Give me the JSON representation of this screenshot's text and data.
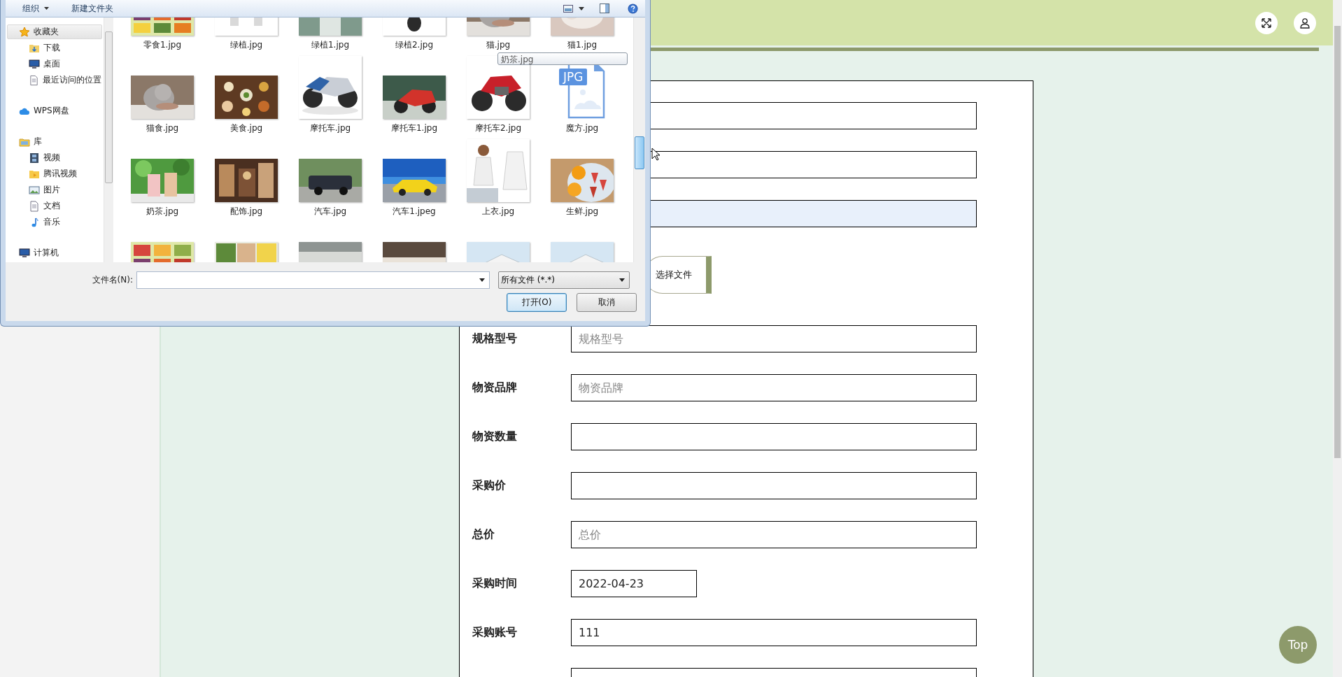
{
  "dialog": {
    "toolbar": {
      "organize": "组织",
      "new_folder": "新建文件夹"
    },
    "nav": [
      {
        "label": "收藏夹",
        "selected": true,
        "children": [
          {
            "label": "下载",
            "selected": false
          },
          {
            "label": "桌面",
            "selected": false
          },
          {
            "label": "最近访问的位置",
            "selected": false
          }
        ]
      },
      {
        "label": "WPS网盘",
        "selected": false
      },
      {
        "label": "库",
        "selected": false,
        "children": [
          {
            "label": "视频",
            "selected": false
          },
          {
            "label": "腾讯视频",
            "selected": false
          },
          {
            "label": "图片",
            "selected": false
          },
          {
            "label": "文档",
            "selected": false
          },
          {
            "label": "音乐",
            "selected": false
          }
        ]
      },
      {
        "label": "计算机",
        "selected": false
      }
    ],
    "files": [
      {
        "kind": "picture",
        "label": "零食1.jpg"
      },
      {
        "kind": "picture",
        "label": "绿植.jpg"
      },
      {
        "kind": "picture",
        "label": "绿植1.jpg"
      },
      {
        "kind": "picture",
        "label": "绿植2.jpg"
      },
      {
        "kind": "picture",
        "label": "猫.jpg"
      },
      {
        "kind": "picture",
        "label": "猫1.jpg"
      },
      {
        "kind": "picture",
        "label": "猫食.jpg"
      },
      {
        "kind": "picture",
        "label": "美食.jpg"
      },
      {
        "kind": "picture",
        "label": "摩托车.jpg"
      },
      {
        "kind": "picture",
        "label": "摩托车1.jpg"
      },
      {
        "kind": "picture",
        "label": "摩托车2.jpg"
      },
      {
        "kind": "file",
        "label": "魔方.jpg",
        "badge": "JPG"
      },
      {
        "kind": "picture",
        "label": "奶茶.jpg"
      },
      {
        "kind": "picture",
        "label": "配饰.jpg"
      },
      {
        "kind": "picture",
        "label": "汽车.jpg"
      },
      {
        "kind": "picture",
        "label": "汽车1.jpeg"
      },
      {
        "kind": "picture",
        "label": "上衣.jpg"
      },
      {
        "kind": "picture",
        "label": "生鲜.jpg"
      },
      {
        "kind": "picture"
      },
      {
        "kind": "picture"
      },
      {
        "kind": "picture"
      },
      {
        "kind": "picture"
      },
      {
        "kind": "picture"
      },
      {
        "kind": "picture"
      }
    ],
    "tooltip": "奶茶.jpg",
    "filename_label": "文件名(N):",
    "filter": "所有文件 (*.*)",
    "buttons": [
      {
        "label": "打开(O)",
        "default": true
      },
      {
        "label": "取消",
        "default": false
      }
    ]
  },
  "form": {
    "fields": [
      {
        "kind": "text",
        "highlighted": false
      },
      {
        "kind": "text",
        "highlighted": false
      },
      {
        "kind": "text",
        "highlighted": true
      },
      {
        "kind": "file",
        "button": "选择文件"
      },
      {
        "kind": "text",
        "label": "规格型号",
        "placeholder": "规格型号",
        "highlighted": false
      },
      {
        "kind": "text",
        "label": "物资品牌",
        "placeholder": "物资品牌",
        "highlighted": false
      },
      {
        "kind": "text",
        "label": "物资数量",
        "highlighted": false
      },
      {
        "kind": "text",
        "label": "采购价",
        "highlighted": false
      },
      {
        "kind": "text",
        "label": "总价",
        "placeholder": "总价",
        "highlighted": false
      },
      {
        "kind": "date",
        "label": "采购时间",
        "value": "2022-04-23"
      },
      {
        "kind": "text",
        "label": "采购账号",
        "value": "111",
        "highlighted": false
      },
      {
        "kind": "text",
        "highlighted": false
      }
    ]
  },
  "top_button": "Top"
}
